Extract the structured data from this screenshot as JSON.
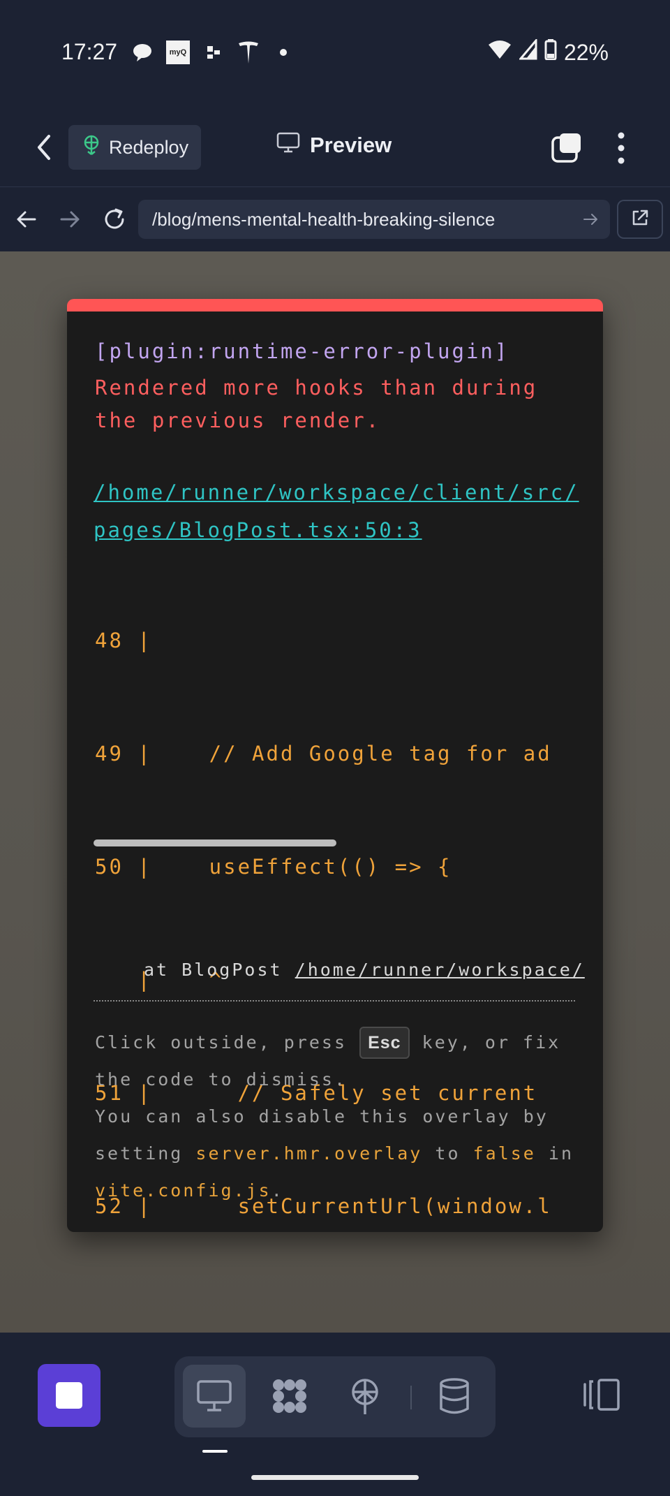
{
  "status_bar": {
    "time": "17:27",
    "notification_icons": [
      "chat-bubble-icon",
      "myq-icon",
      "dots-icon",
      "tesla-icon",
      "dot-icon"
    ],
    "myq_label": "myQ",
    "battery": "22%"
  },
  "header": {
    "redeploy_label": "Redeploy",
    "title": "Preview"
  },
  "url_bar": {
    "url": "/blog/mens-mental-health-breaking-silence"
  },
  "error_overlay": {
    "plugin": "[plugin:runtime-error-plugin]",
    "message": "Rendered more hooks than during the previous render.",
    "file": "/home/runner/workspace/client/src/pages/BlogPost.tsx:50:3",
    "code_lines": [
      "48 |",
      "49 |    // Add Google tag for ad",
      "50 |    useEffect(() => {",
      "   |    ^",
      "51 |      // Safely set current",
      "52 |      setCurrentUrl(window.l"
    ],
    "stack_prefix": "at BlogPost",
    "stack_link": "/home/runner/workspace/",
    "tip_1_a": "Click outside, press",
    "tip_1_key": "Esc",
    "tip_1_b": "key, or fix the code to dismiss.",
    "tip_2_a": "You can also disable this overlay by setting",
    "tip_2_code": "server.hmr.overlay",
    "tip_2_b": "to",
    "tip_2_false": "false",
    "tip_2_c": "in",
    "tip_2_file": "vite.config.js",
    "tip_2_end": "."
  },
  "toolbar": {
    "tools": [
      "preview-monitor-icon",
      "workflow-icon",
      "deploy-icon",
      "database-icon"
    ],
    "accent": "#5b3fd6"
  }
}
